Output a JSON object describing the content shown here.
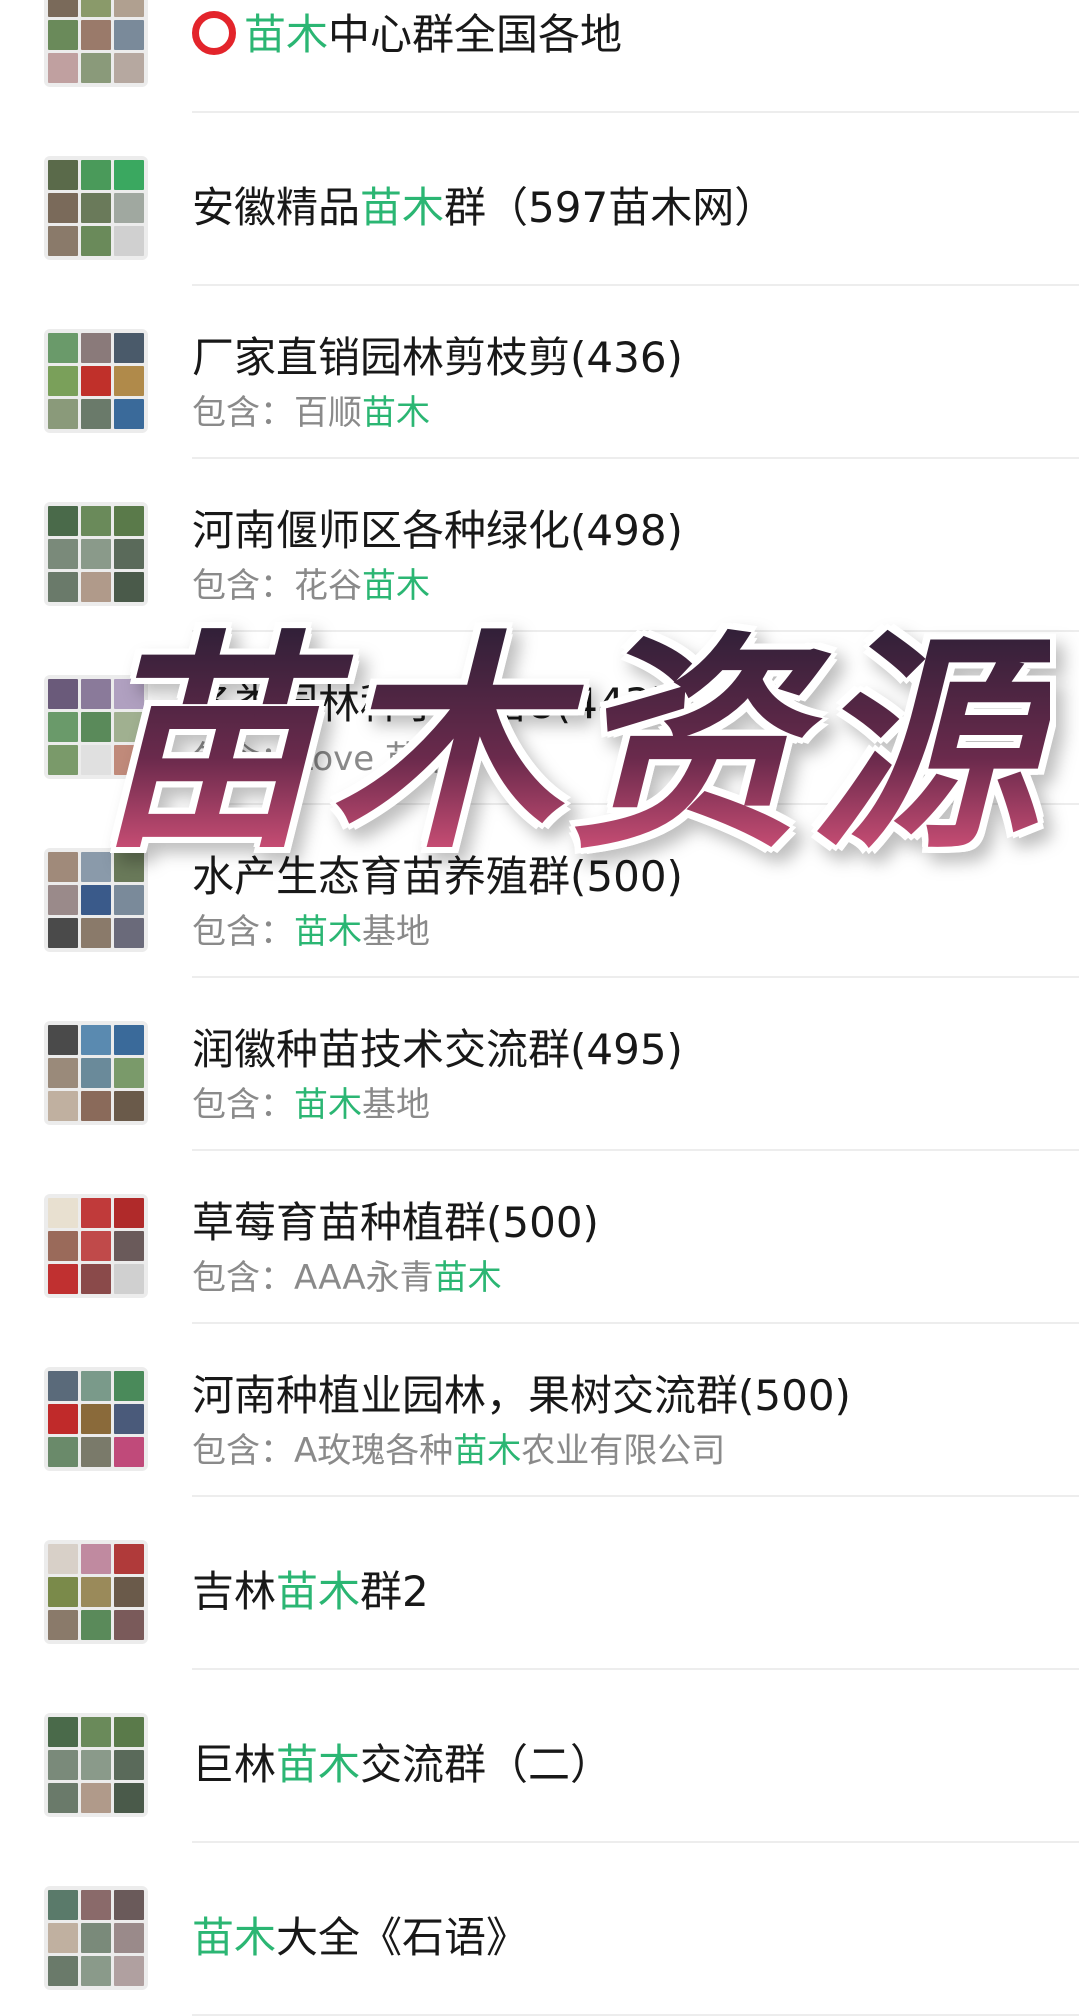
{
  "groups": [
    {
      "title_parts": [
        {
          "t": "",
          "ring": true
        },
        {
          "t": "苗木",
          "hl": true
        },
        {
          "t": "中心群全国各地"
        }
      ],
      "sub_parts": [],
      "avatar_colors": [
        "#7a6a5a",
        "#8a9a6a",
        "#b0a090",
        "#6a8a5a",
        "#9a7a6a",
        "#7a8a9a",
        "#c0a0a0",
        "#8a9a7a",
        "#b6a8a0"
      ]
    },
    {
      "title_parts": [
        {
          "t": "安徽精品"
        },
        {
          "t": "苗木",
          "hl": true
        },
        {
          "t": "群（597苗木网）"
        }
      ],
      "sub_parts": [],
      "avatar_colors": [
        "#5a6a4a",
        "#4a9a5a",
        "#3aa860",
        "#7a6a5a",
        "#6a7a5a",
        "#a0a8a0",
        "#8a7a6a",
        "#6a8a5a",
        "#d0d0d0"
      ]
    },
    {
      "title_parts": [
        {
          "t": "厂家直销园林剪枝剪(436)"
        }
      ],
      "sub_parts": [
        {
          "t": "包含：百顺"
        },
        {
          "t": "苗木",
          "hl": true
        }
      ],
      "avatar_colors": [
        "#6a9a6a",
        "#8a7a7a",
        "#4a5a6a",
        "#7aa05a",
        "#c0302a",
        "#b08a4a",
        "#8a9a7a",
        "#6a7a6a",
        "#3a6a9a"
      ]
    },
    {
      "title_parts": [
        {
          "t": "河南偃师区各种绿化(498)"
        }
      ],
      "sub_parts": [
        {
          "t": "包含：花谷"
        },
        {
          "t": "苗木",
          "hl": true
        }
      ],
      "avatar_colors": [
        "#4a6a4a",
        "#6a8a5a",
        "#5a7a4a",
        "#7a8a7a",
        "#8a9a8a",
        "#5a6a5a",
        "#6a7a6a",
        "#b09a8a",
        "#4a5a4a"
      ]
    },
    {
      "title_parts": [
        {
          "t": "各类园林种子种苗8(443)"
        }
      ],
      "sub_parts": [
        {
          "t": "包含：Love 苗木"
        }
      ],
      "avatar_colors": [
        "#6a5a7a",
        "#8a7a9a",
        "#b0a0c0",
        "#6a9a6a",
        "#5a8a5a",
        "#a0b090",
        "#7a9a6a",
        "#e0e0e0",
        "#c08a7a"
      ]
    },
    {
      "title_parts": [
        {
          "t": "水产生态育苗养殖群(500)"
        }
      ],
      "sub_parts": [
        {
          "t": "包含："
        },
        {
          "t": "苗木",
          "hl": true
        },
        {
          "t": "基地"
        }
      ],
      "avatar_colors": [
        "#a08a7a",
        "#8a9aaa",
        "#6a7a5a",
        "#9a8a8a",
        "#3a5a8a",
        "#7a8a9a",
        "#4a4a4a",
        "#8a7a6a",
        "#6a6a7a"
      ]
    },
    {
      "title_parts": [
        {
          "t": "润徽种苗技术交流群(495)"
        }
      ],
      "sub_parts": [
        {
          "t": "包含："
        },
        {
          "t": "苗木",
          "hl": true
        },
        {
          "t": "基地"
        }
      ],
      "avatar_colors": [
        "#4a4a4a",
        "#5a8ab0",
        "#3a6a9a",
        "#9a8a7a",
        "#6a8a9a",
        "#7a9a6a",
        "#c0b0a0",
        "#8a6a5a",
        "#6a5a4a"
      ]
    },
    {
      "title_parts": [
        {
          "t": "草莓育苗种植群(500)"
        }
      ],
      "sub_parts": [
        {
          "t": "包含：AAA永青"
        },
        {
          "t": "苗木",
          "hl": true
        }
      ],
      "avatar_colors": [
        "#e8e0d0",
        "#c03a3a",
        "#b02a2a",
        "#9a6a5a",
        "#c04a4a",
        "#6a5a5a",
        "#c03030",
        "#8a4a4a",
        "#d0d0d0"
      ]
    },
    {
      "title_parts": [
        {
          "t": "河南种植业园林，果树交流群(500)"
        }
      ],
      "sub_parts": [
        {
          "t": "包含：A玫瑰各种"
        },
        {
          "t": "苗木",
          "hl": true
        },
        {
          "t": "农业有限公司"
        }
      ],
      "avatar_colors": [
        "#5a6a7a",
        "#7a9a8a",
        "#4a8a5a",
        "#c02a2a",
        "#8a6a3a",
        "#4a5a7a",
        "#6a8a6a",
        "#7a7a6a",
        "#c04a7a"
      ]
    },
    {
      "title_parts": [
        {
          "t": "吉林"
        },
        {
          "t": "苗木",
          "hl": true
        },
        {
          "t": "群2"
        }
      ],
      "sub_parts": [],
      "avatar_colors": [
        "#d8d0c8",
        "#c08aa0",
        "#b03a3a",
        "#7a8a4a",
        "#9a8a5a",
        "#6a5a4a",
        "#8a7a6a",
        "#5a8a5a",
        "#7a5a5a"
      ]
    },
    {
      "title_parts": [
        {
          "t": "巨林"
        },
        {
          "t": "苗木",
          "hl": true
        },
        {
          "t": "交流群（二）"
        }
      ],
      "sub_parts": [],
      "avatar_colors": [
        "#4a6a4a",
        "#6a8a5a",
        "#5a7a4a",
        "#7a8a7a",
        "#8a9a8a",
        "#5a6a5a",
        "#6a7a6a",
        "#b09a8a",
        "#4a5a4a"
      ]
    },
    {
      "title_parts": [
        {
          "t": "苗木",
          "hl": true
        },
        {
          "t": "大全《石语》"
        }
      ],
      "sub_parts": [],
      "avatar_colors": [
        "#5a7a6a",
        "#8a6a6a",
        "#6a5a5a",
        "#c0b0a0",
        "#7a8a7a",
        "#9a8a8a",
        "#6a7a6a",
        "#8a9a8a",
        "#b0a0a0"
      ]
    }
  ],
  "overlay": {
    "title": "苗木资源"
  }
}
